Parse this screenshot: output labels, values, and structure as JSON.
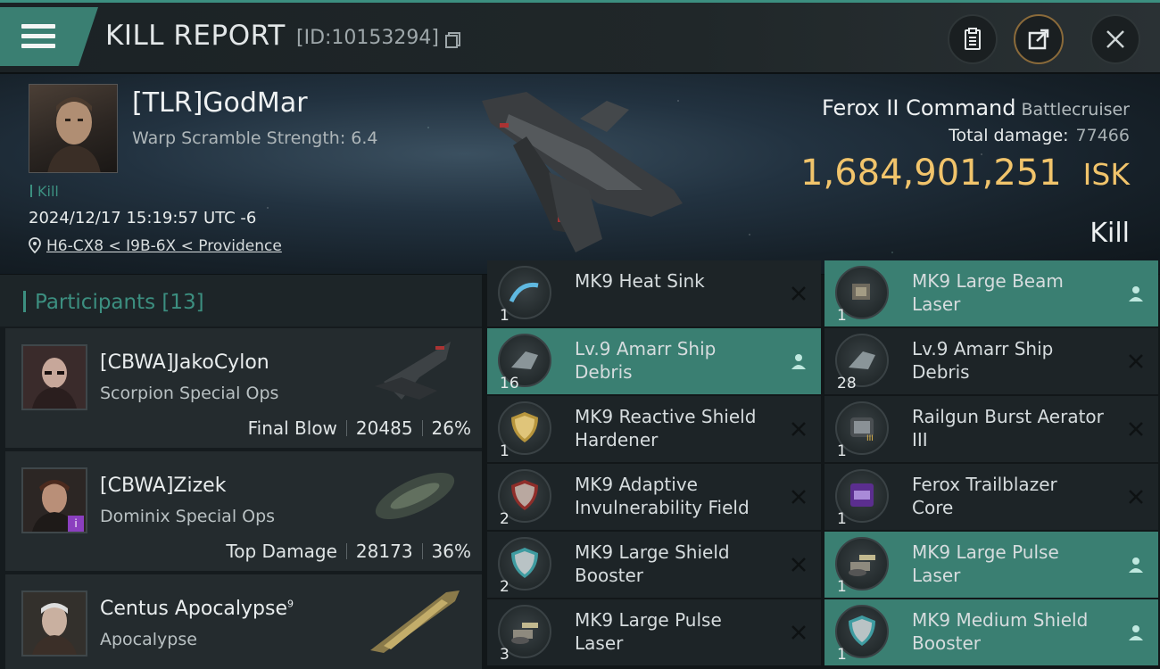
{
  "header": {
    "title": "KILL REPORT",
    "report_id": "[ID:10153294]",
    "menu_icon": "hamburger-menu-icon",
    "buttons": [
      "clipboard-icon",
      "share-icon",
      "close-icon"
    ]
  },
  "victim": {
    "name": "[TLR]GodMar",
    "warp_scramble": "Warp Scramble Strength: 6.4",
    "tag": "Kill",
    "timestamp": "2024/12/17 15:19:57 UTC -6",
    "location": "H6-CX8 < I9B-6X < Providence",
    "ship_name": "Ferox II Command",
    "ship_class": "Battlecruiser",
    "total_damage_label": "Total damage:",
    "total_damage_value": "77466",
    "isk_amount": "1,684,901,251",
    "isk_unit": "ISK",
    "result": "Kill"
  },
  "participants": {
    "label": "Participants",
    "count": "[13]",
    "list": [
      {
        "name": "[CBWA]JakoCylon",
        "ship": "Scorpion Special Ops",
        "stat_label": "Final Blow",
        "damage": "20485",
        "percent": "26%"
      },
      {
        "name": "[CBWA]Zizek",
        "ship": "Dominix Special Ops",
        "stat_label": "Top Damage",
        "damage": "28173",
        "percent": "36%"
      },
      {
        "name": "Centus Apocalypse",
        "name_sup": "9",
        "ship": "Apocalypse"
      }
    ]
  },
  "items": {
    "left": [
      {
        "qty": "1",
        "line1": "MK9 Heat Sink",
        "line2": "",
        "action": "close-icon"
      },
      {
        "qty": "16",
        "line1": "Lv.9 Amarr Ship",
        "line2": "Debris",
        "action": "person-icon"
      },
      {
        "qty": "1",
        "line1": "MK9 Reactive Shield",
        "line2": "Hardener",
        "action": "close-icon"
      },
      {
        "qty": "2",
        "line1": "MK9 Adaptive",
        "line2": "Invulnerability Field",
        "action": "close-icon"
      },
      {
        "qty": "2",
        "line1": "MK9 Large Shield",
        "line2": "Booster",
        "action": "close-icon"
      },
      {
        "qty": "3",
        "line1": "MK9 Large Pulse",
        "line2": "Laser",
        "action": "close-icon"
      }
    ],
    "right": [
      {
        "qty": "1",
        "line1": "MK9 Large Beam",
        "line2": "Laser",
        "action": "person-icon"
      },
      {
        "qty": "28",
        "line1": "Lv.9 Amarr Ship",
        "line2": "Debris",
        "action": "close-icon"
      },
      {
        "qty": "1",
        "line1": "Railgun Burst Aerator",
        "line2": "III",
        "action": "close-icon"
      },
      {
        "qty": "1",
        "line1": "Ferox Trailblazer",
        "line2": "Core",
        "action": "close-icon"
      },
      {
        "qty": "1",
        "line1": "MK9 Large Pulse",
        "line2": "Laser",
        "action": "person-icon"
      },
      {
        "qty": "1",
        "line1": "MK9 Medium Shield",
        "line2": "Booster",
        "action": "person-icon"
      }
    ]
  },
  "colors": {
    "accent_teal": "#3a7f72",
    "isk_gold": "#f1c46b",
    "background": "#121719"
  }
}
